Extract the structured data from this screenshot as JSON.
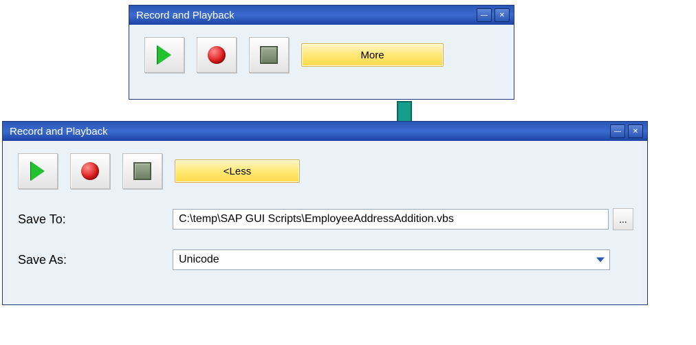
{
  "window_small": {
    "title": "Record and Playback",
    "more_label": "More"
  },
  "window_large": {
    "title": "Record and Playback",
    "less_label": "<Less",
    "save_to_label": "Save To:",
    "save_to_value": "C:\\temp\\SAP GUI Scripts\\EmployeeAddressAddition.vbs",
    "browse_label": "...",
    "save_as_label": "Save As:",
    "save_as_value": "Unicode"
  }
}
